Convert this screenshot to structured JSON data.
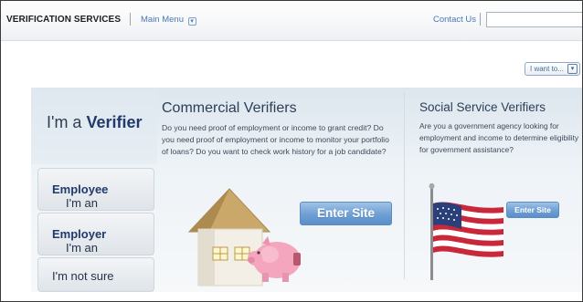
{
  "header": {
    "brand": "VERIFICATION SERVICES",
    "main_menu": "Main Menu",
    "contact_us": "Contact Us",
    "search_placeholder": ""
  },
  "iwant": {
    "label": "I want to..."
  },
  "sidebar": {
    "verifier": {
      "prefix": "I'm a",
      "strong": "Verifier"
    },
    "items": [
      {
        "prefix": "I'm an",
        "strong": "Employee"
      },
      {
        "prefix": "I'm an",
        "strong": "Employer"
      },
      {
        "prefix": "",
        "strong": "",
        "plain": "I'm not sure"
      }
    ]
  },
  "commercial": {
    "title": "Commercial Verifiers",
    "text": "Do you need proof of employment or income to grant credit? Do you need proof of employment or income to monitor your portfolio of loans? Do you want to check work history for a job candidate?",
    "button": "Enter Site"
  },
  "social": {
    "title": "Social Service Verifiers",
    "text": "Are you a government agency looking for employment and income to determine eligibility for government assistance?",
    "button": "Enter Site"
  },
  "colors": {
    "accent": "#4a78b8",
    "button": "#6e9fd3",
    "panel": "#e6edf3"
  }
}
